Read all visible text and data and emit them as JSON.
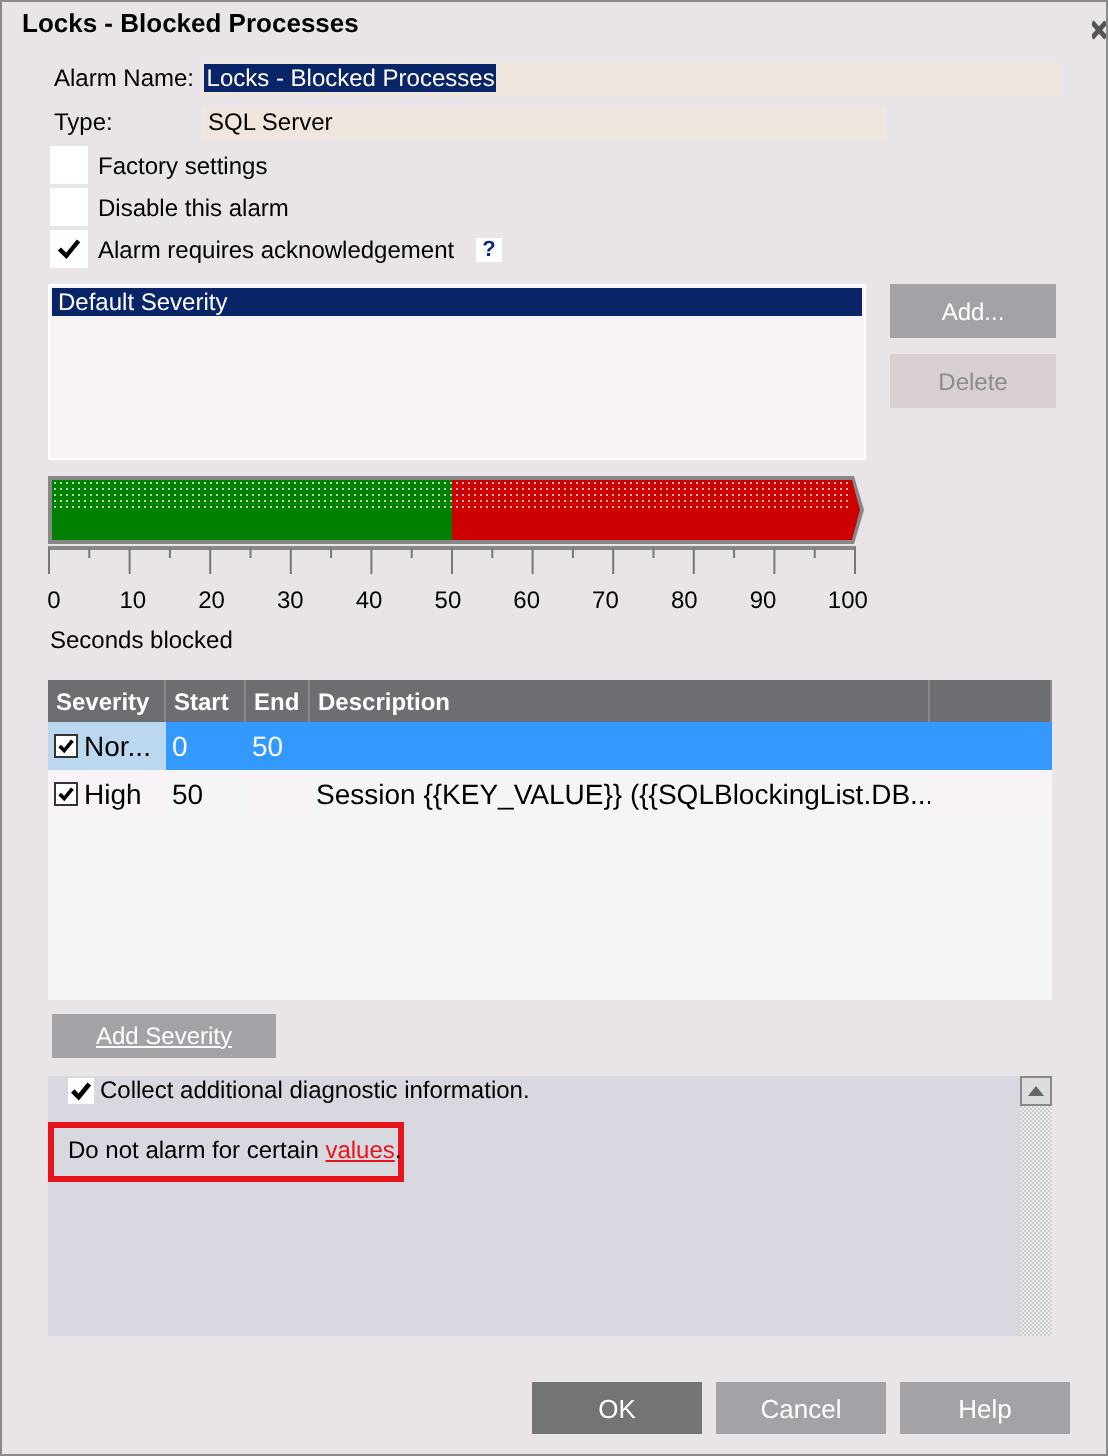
{
  "window": {
    "title": "Locks - Blocked Processes"
  },
  "fields": [
    {
      "label": "Alarm Name:",
      "value": "Locks - Blocked Processes",
      "selected": true
    },
    {
      "label": "Type:",
      "value": "SQL Server",
      "selected": false
    }
  ],
  "options": [
    {
      "label": "Factory settings",
      "checked": false
    },
    {
      "label": "Disable this alarm",
      "checked": false
    },
    {
      "label": "Alarm requires acknowledgement",
      "checked": true,
      "help": "?"
    }
  ],
  "severity_list": {
    "items": [
      {
        "label": "Default Severity",
        "selected": true
      }
    ]
  },
  "list_buttons": [
    {
      "label": "Add...",
      "disabled": false
    },
    {
      "label": "Delete",
      "disabled": true
    }
  ],
  "scale": {
    "ticks": [
      "0",
      "10",
      "20",
      "30",
      "40",
      "50",
      "60",
      "70",
      "80",
      "90",
      "100"
    ],
    "caption": "Seconds blocked"
  },
  "table": {
    "columns": [
      "Severity",
      "Start",
      "End",
      "Description"
    ],
    "rows": [
      {
        "checked": true,
        "selected": true,
        "color": "#008000",
        "severity": "Nor...",
        "start": "0",
        "end": "50",
        "description": ""
      },
      {
        "checked": true,
        "selected": false,
        "color": "#cc0000",
        "severity": "High",
        "start": "50",
        "end": "",
        "description": "Session {{KEY_VALUE}} ({{SQLBlockingList.DB..."
      }
    ]
  },
  "add_severity": "Add Severity",
  "diagnostics": {
    "checkbox": {
      "label": "Collect additional diagnostic information.",
      "checked": true
    },
    "note": {
      "before": "Do not alarm for certain ",
      "link": "values",
      "after": "."
    }
  },
  "buttons": [
    {
      "label": "OK",
      "kind": "primary"
    },
    {
      "label": "Cancel",
      "kind": "normal"
    },
    {
      "label": "Help",
      "kind": "normal"
    }
  ]
}
